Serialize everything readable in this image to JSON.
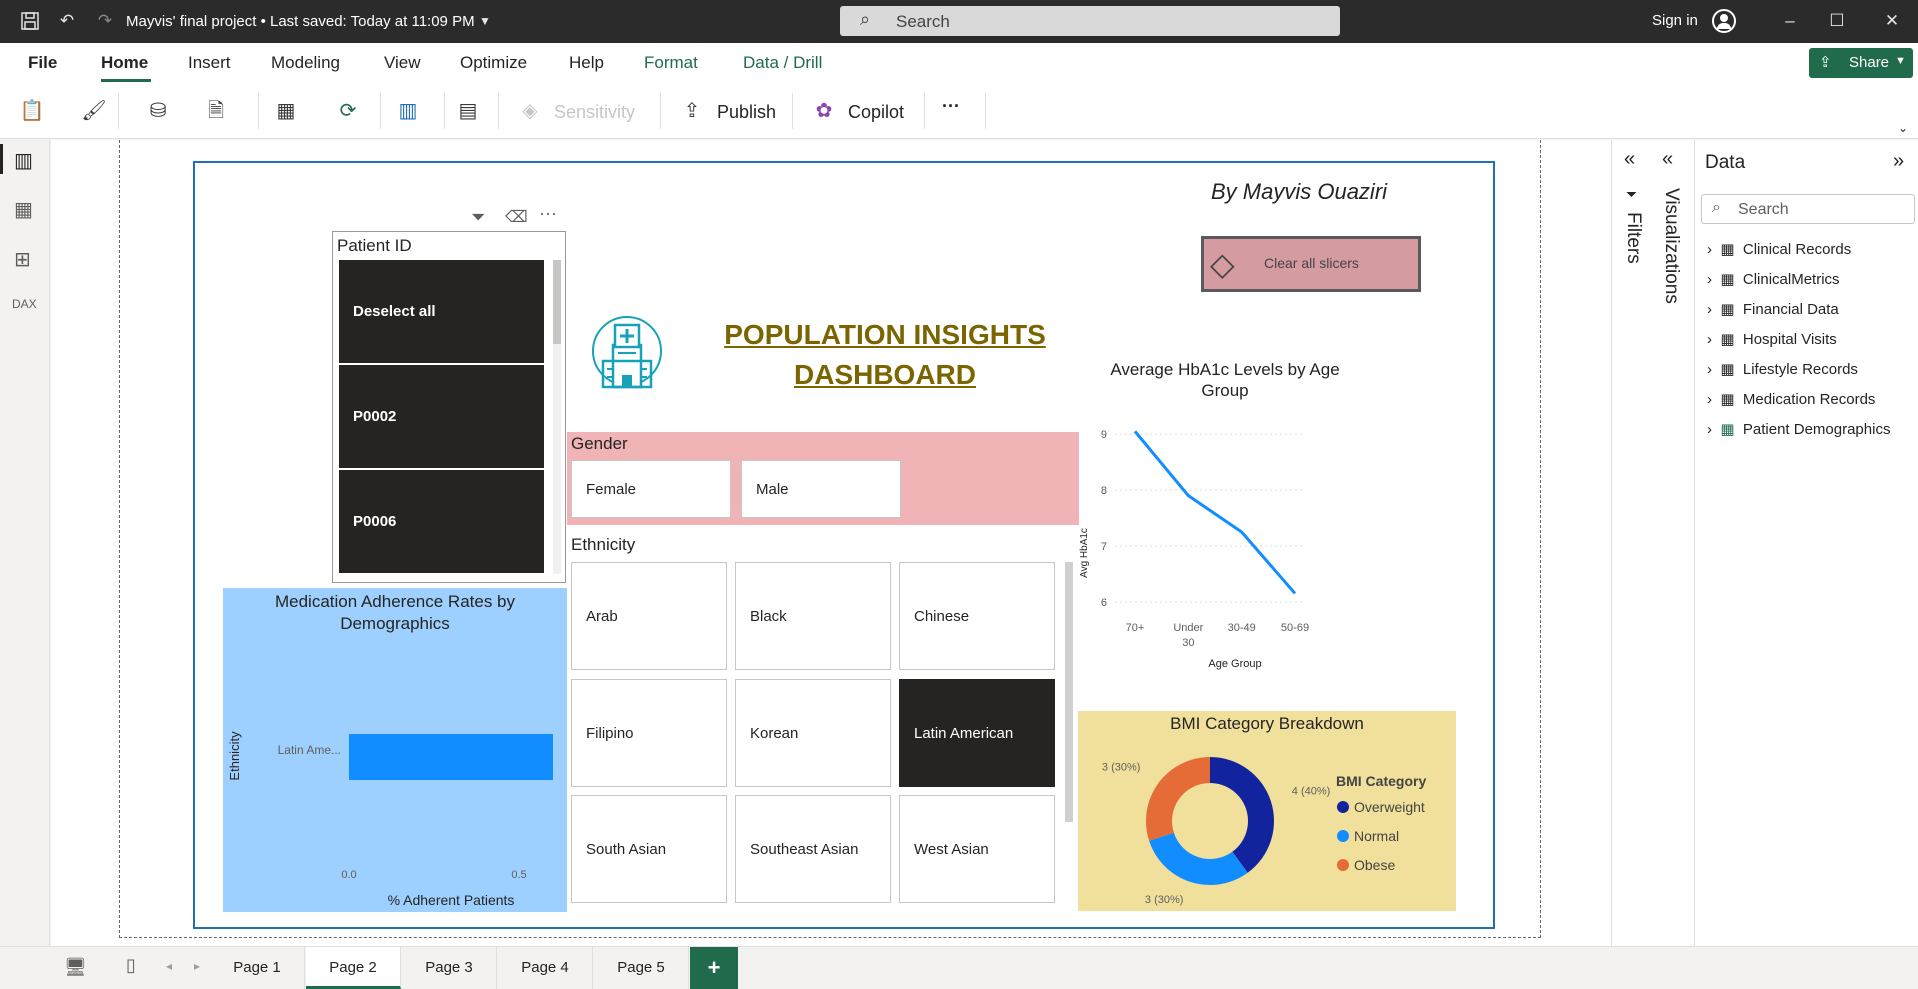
{
  "titlebar": {
    "title": "Mayvis' final project • Last saved: Today at 11:09 PM",
    "search_placeholder": "Search",
    "signin_label": "Sign in"
  },
  "menu": [
    "File",
    "Home",
    "Insert",
    "Modeling",
    "View",
    "Optimize",
    "Help",
    "Format",
    "Data / Drill"
  ],
  "share_label": "Share",
  "ribbon": {
    "sensitivity": "Sensitivity",
    "publish": "Publish",
    "copilot": "Copilot",
    "more": "···"
  },
  "report": {
    "author": "By Mayvis Ouaziri",
    "clear_slicers": "Clear all slicers",
    "title_line1": "POPULATION INSIGHTS ",
    "title_line2": "DASHBOARD",
    "patient_slicer": {
      "header": "Patient ID",
      "items": [
        "Deselect all",
        "P0002",
        "P0006"
      ]
    },
    "gender": {
      "header": "Gender",
      "items": [
        "Female",
        "Male"
      ]
    },
    "ethnicity": {
      "header": "Ethnicity",
      "items": [
        "Arab",
        "Black",
        "Chinese",
        "Filipino",
        "Korean",
        "Latin American",
        "South Asian",
        "Southeast Asian",
        "West Asian"
      ],
      "selected": "Latin American"
    },
    "colors": {
      "accent": "#118dff",
      "gender_bg": "#f0b3b6",
      "med_bg": "#9ed0ff",
      "bmi_bg": "#f0e09b",
      "title": "#7a6500"
    }
  },
  "chart_data": [
    {
      "type": "line",
      "title": "Average HbA1c Levels by Age Group",
      "xlabel": "Age Group",
      "ylabel": "Avg HbA1c",
      "categories": [
        "70+",
        "Under 30",
        "30-49",
        "50-69"
      ],
      "values": [
        9.05,
        7.9,
        7.25,
        6.15
      ],
      "yticks": [
        6,
        7,
        8,
        9
      ],
      "ylim": [
        5.8,
        9.2
      ],
      "grid": true
    },
    {
      "type": "bar",
      "orientation": "horizontal",
      "title": "Medication Adherence Rates by Demographics",
      "xlabel": "% Adherent Patients",
      "ylabel": "Ethnicity",
      "categories": [
        "Latin Ame..."
      ],
      "values": [
        0.6
      ],
      "xticks": [
        "0.0",
        "0.5"
      ],
      "xlim": [
        0,
        0.6
      ]
    },
    {
      "type": "pie",
      "title": "BMI Category Breakdown",
      "legend_title": "BMI Category",
      "legend_placement": "right",
      "labels": [
        "Overweight",
        "Normal",
        "Obese"
      ],
      "values": [
        4,
        3,
        3
      ],
      "data_labels": [
        "4 (40%)",
        "3 (30%)",
        "3 (30%)"
      ],
      "colors": [
        "#12239e",
        "#118dff",
        "#e66c37"
      ]
    }
  ],
  "data_pane": {
    "title": "Data",
    "search_placeholder": "Search",
    "tables": [
      "Clinical Records",
      "ClinicalMetrics",
      "Financial Data",
      "Hospital Visits",
      "Lifestyle Records",
      "Medication Records",
      "Patient Demographics"
    ]
  },
  "side_labels": {
    "filters": "Filters",
    "visualizations": "Visualizations"
  },
  "pages": [
    "Page 1",
    "Page 2",
    "Page 3",
    "Page 4",
    "Page 5"
  ],
  "active_page": "Page 2"
}
